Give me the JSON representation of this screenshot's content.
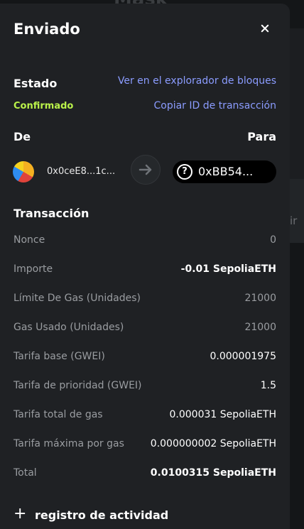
{
  "background": {
    "title_fragment": "Mask",
    "side_text": "ir"
  },
  "header": {
    "title": "Enviado",
    "close_icon": "close-icon"
  },
  "status": {
    "label": "Estado",
    "value": "Confirmado",
    "value_color": "#baf24a",
    "explorer_link": "Ver en el explorador de bloques",
    "copy_link": "Copiar ID de transacción"
  },
  "parties": {
    "from_label": "De",
    "to_label": "Para",
    "from_address": "0x0ceE8...1c...",
    "to_address": "0xBB54...",
    "arrow_icon": "arrow-right-icon",
    "to_icon": "question-icon"
  },
  "transaction": {
    "title": "Transacción",
    "rows": [
      {
        "label": "Nonce",
        "value": "0"
      },
      {
        "label": "Importe",
        "value": "-0.01 SepoliaETH"
      },
      {
        "label": "Límite De Gas (Unidades)",
        "value": "21000"
      },
      {
        "label": "Gas Usado (Unidades)",
        "value": "21000"
      },
      {
        "label": "Tarifa base (GWEI)",
        "value": "0.000001975"
      },
      {
        "label": "Tarifa de prioridad (GWEI)",
        "value": "1.5"
      },
      {
        "label": "Tarifa total de gas",
        "value": "0.000031 SepoliaETH"
      },
      {
        "label": "Tarifa máxima por gas",
        "value": "0.000000002 SepoliaETH"
      },
      {
        "label": "Total",
        "value": "0.0100315 SepoliaETH"
      }
    ]
  },
  "activity": {
    "plus_icon": "+",
    "label": "registro de actividad"
  },
  "colors": {
    "link": "#8b9cff",
    "modal_bg": "#1f2124"
  }
}
